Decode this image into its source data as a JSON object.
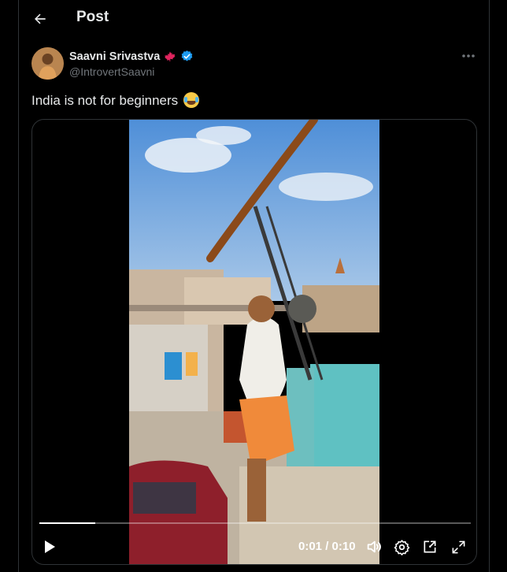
{
  "header": {
    "title": "Post"
  },
  "author": {
    "name": "Saavni Srivastva",
    "handle": "@IntrovertSaavni"
  },
  "tweet": {
    "text": "India is not for beginners",
    "emoji": "face-with-tears-of-joy"
  },
  "video": {
    "current_time": "0:01",
    "duration": "0:10",
    "time_display": "0:01 / 0:10",
    "progress": 0.13
  },
  "colors": {
    "background": "#000000",
    "text": "#e7e9ea",
    "secondary_text": "#71767b",
    "verified": "#1d9bf0",
    "maple": "#e0245e",
    "border": "#2f3336"
  },
  "icons": {
    "back": "arrow-left-icon",
    "flag": "maple-leaf-icon",
    "verified": "verified-badge-icon",
    "more": "more-icon",
    "play": "play-icon",
    "volume": "volume-icon",
    "settings": "settings-icon",
    "pip": "picture-in-picture-icon",
    "fullscreen": "fullscreen-icon"
  }
}
